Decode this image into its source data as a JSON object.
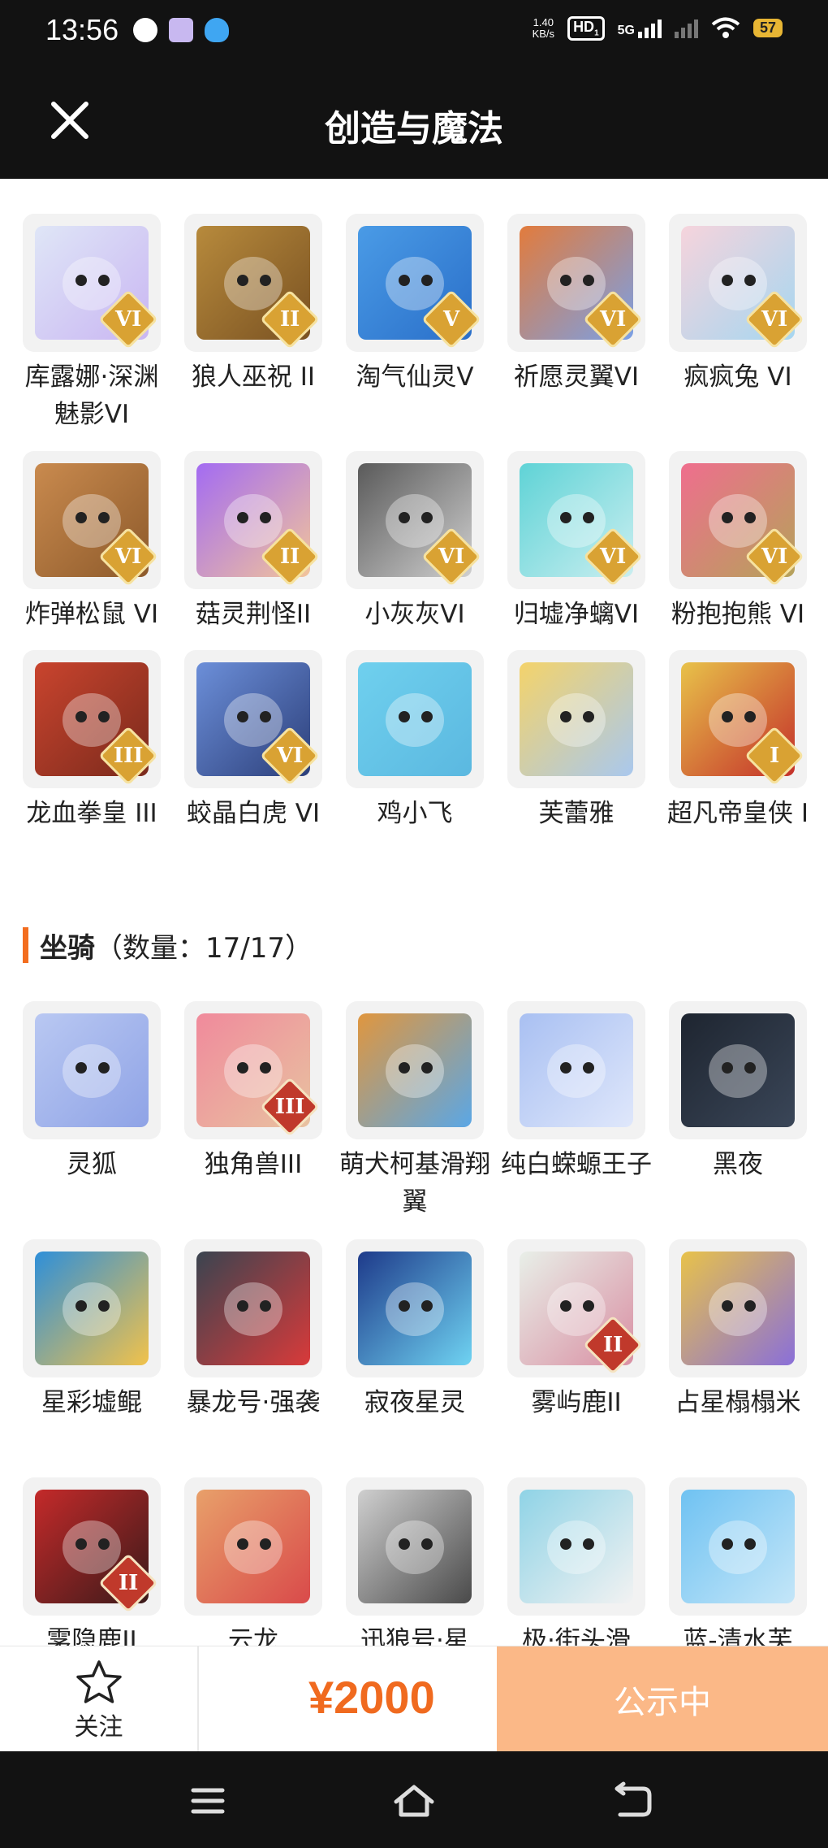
{
  "status_bar": {
    "time": "13:56",
    "net_speed": "1.40",
    "net_unit": "KB/s",
    "hd": "HD",
    "hd_sub": "1",
    "signal": "5G",
    "battery": "57"
  },
  "header": {
    "title": "创造与魔法",
    "close_icon": "close-icon"
  },
  "pets": [
    {
      "name": "库露娜·深渊魅影VI",
      "tier": "VI",
      "colors": [
        "#dfe6f7",
        "#c9b6f2"
      ]
    },
    {
      "name": "狼人巫祝 II",
      "tier": "II",
      "colors": [
        "#b78a3c",
        "#7a5222"
      ]
    },
    {
      "name": "淘气仙灵V",
      "tier": "V",
      "colors": [
        "#4a9be6",
        "#2a6fc9"
      ]
    },
    {
      "name": "祈愿灵翼VI",
      "tier": "VI",
      "colors": [
        "#e27b3c",
        "#7aa0e6"
      ]
    },
    {
      "name": "疯疯兔 VI",
      "tier": "VI",
      "colors": [
        "#f6d4dc",
        "#a6d6f0"
      ]
    },
    {
      "name": "炸弹松鼠 VI",
      "tier": "VI",
      "colors": [
        "#c98a4e",
        "#8d5a2b"
      ]
    },
    {
      "name": "菇灵荆怪II",
      "tier": "II",
      "colors": [
        "#a36bf2",
        "#f2c49a"
      ]
    },
    {
      "name": "小灰灰VI",
      "tier": "VI",
      "colors": [
        "#5a5a5a",
        "#cfcfcf"
      ]
    },
    {
      "name": "归墟净螭VI",
      "tier": "VI",
      "colors": [
        "#5fd3d6",
        "#c9eef0"
      ]
    },
    {
      "name": "粉抱抱熊 VI",
      "tier": "VI",
      "colors": [
        "#ef6e8e",
        "#b5a25a"
      ]
    },
    {
      "name": "龙血拳皇 III",
      "tier": "III",
      "colors": [
        "#c9442e",
        "#7a2a1c"
      ]
    },
    {
      "name": "蛟晶白虎 VI",
      "tier": "VI",
      "colors": [
        "#6c8fd9",
        "#2c3f7a"
      ]
    },
    {
      "name": "鸡小飞",
      "tier": "",
      "colors": [
        "#6fd0ee",
        "#5bb8e0"
      ]
    },
    {
      "name": "芙蕾雅",
      "tier": "",
      "colors": [
        "#f4d36a",
        "#a9c8ee"
      ]
    },
    {
      "name": "超凡帝皇侠 I",
      "tier": "I",
      "colors": [
        "#e8c24a",
        "#c4302a"
      ]
    }
  ],
  "mounts_section": {
    "title": "坐骑",
    "count_text": "（数量：17/17）"
  },
  "mounts": [
    {
      "name": "灵狐",
      "tier": "",
      "colors": [
        "#b9c8f2",
        "#8fa3e6"
      ]
    },
    {
      "name": "独角兽III",
      "tier": "III",
      "colors": [
        "#f08a9c",
        "#e8c2a0"
      ]
    },
    {
      "name": "萌犬柯基滑翔翼",
      "tier": "",
      "colors": [
        "#e0963e",
        "#5aa7e6"
      ]
    },
    {
      "name": "纯白蝾螈王子",
      "tier": "",
      "colors": [
        "#a9c0f2",
        "#dfe7fb"
      ]
    },
    {
      "name": "黑夜",
      "tier": "",
      "colors": [
        "#1e2530",
        "#3a4658"
      ]
    },
    {
      "name": "星彩墟鲲",
      "tier": "",
      "colors": [
        "#2e8fd9",
        "#f2c24a"
      ]
    },
    {
      "name": "暴龙号·强袭",
      "tier": "",
      "colors": [
        "#3a4450",
        "#d93a3a"
      ]
    },
    {
      "name": "寂夜星灵",
      "tier": "",
      "colors": [
        "#1e3a8a",
        "#6fd3f2"
      ]
    },
    {
      "name": "雾屿鹿II",
      "tier": "II",
      "colors": [
        "#e8efe8",
        "#d98fa3"
      ]
    },
    {
      "name": "占星榻榻米",
      "tier": "",
      "colors": [
        "#e8c24a",
        "#8a6fd9"
      ]
    },
    {
      "name": "雺隐鹿II",
      "tier": "II",
      "colors": [
        "#c42a2a",
        "#3a1a1a"
      ]
    },
    {
      "name": "云龙",
      "tier": "",
      "colors": [
        "#e8a06a",
        "#d94a4a"
      ]
    },
    {
      "name": "迅狼号·星",
      "tier": "",
      "colors": [
        "#cfcfcf",
        "#4a4a4a"
      ]
    },
    {
      "name": "极·街头滑",
      "tier": "",
      "colors": [
        "#8fd3e6",
        "#f2f2f2"
      ]
    },
    {
      "name": "蓝-清水芙",
      "tier": "",
      "colors": [
        "#6fc2f2",
        "#c4e6f8"
      ]
    }
  ],
  "footer": {
    "follow_label": "关注",
    "price": "¥2000",
    "status_button": "公示中"
  },
  "colors": {
    "accent": "#f36d1f",
    "button": "#fbb887",
    "dark": "#121212"
  }
}
